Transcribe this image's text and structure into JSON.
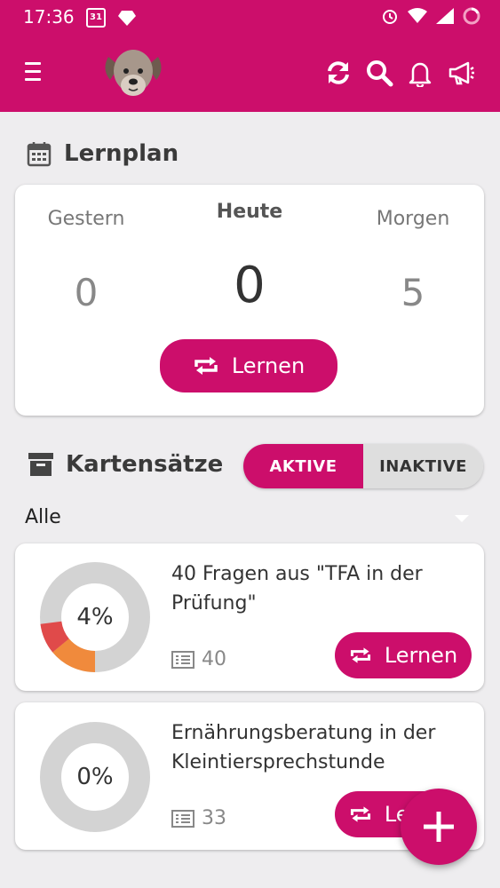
{
  "status_bar": {
    "time": "17:36",
    "calendar_day": "31"
  },
  "app_bar": {
    "menu_icon": "menu-icon",
    "logo_icon": "dog-logo-icon",
    "actions": [
      "sync-icon",
      "search-icon",
      "bell-icon",
      "megaphone-icon"
    ]
  },
  "lernplan": {
    "title": "Lernplan",
    "gestern": {
      "label": "Gestern",
      "value": "0"
    },
    "heute": {
      "label": "Heute",
      "value": "0"
    },
    "morgen": {
      "label": "Morgen",
      "value": "5"
    },
    "button_label": "Lernen"
  },
  "kartensaetze": {
    "title": "Kartensätze",
    "toggle": {
      "active_label": "AKTIVE",
      "inactive_label": "INAKTIVE",
      "selected": "AKTIVE"
    },
    "filter_value": "Alle"
  },
  "decks": [
    {
      "title": "40 Fragen aus \"TFA in der Prüfung\"",
      "percent": "4%",
      "count": "40",
      "button_label": "Lernen",
      "progress": {
        "orange": 0.14,
        "red": 0.09
      }
    },
    {
      "title": "Ernährungsberatung in der Kleintiersprechstunde",
      "percent": "0%",
      "count": "33",
      "button_label": "Lernen",
      "progress": {
        "orange": 0,
        "red": 0
      }
    }
  ],
  "colors": {
    "brand": "#cc0e6b",
    "orange": "#f08a3c",
    "red": "#e04a4a",
    "ring": "#d3d3d3"
  },
  "fab_icon": "plus-icon"
}
